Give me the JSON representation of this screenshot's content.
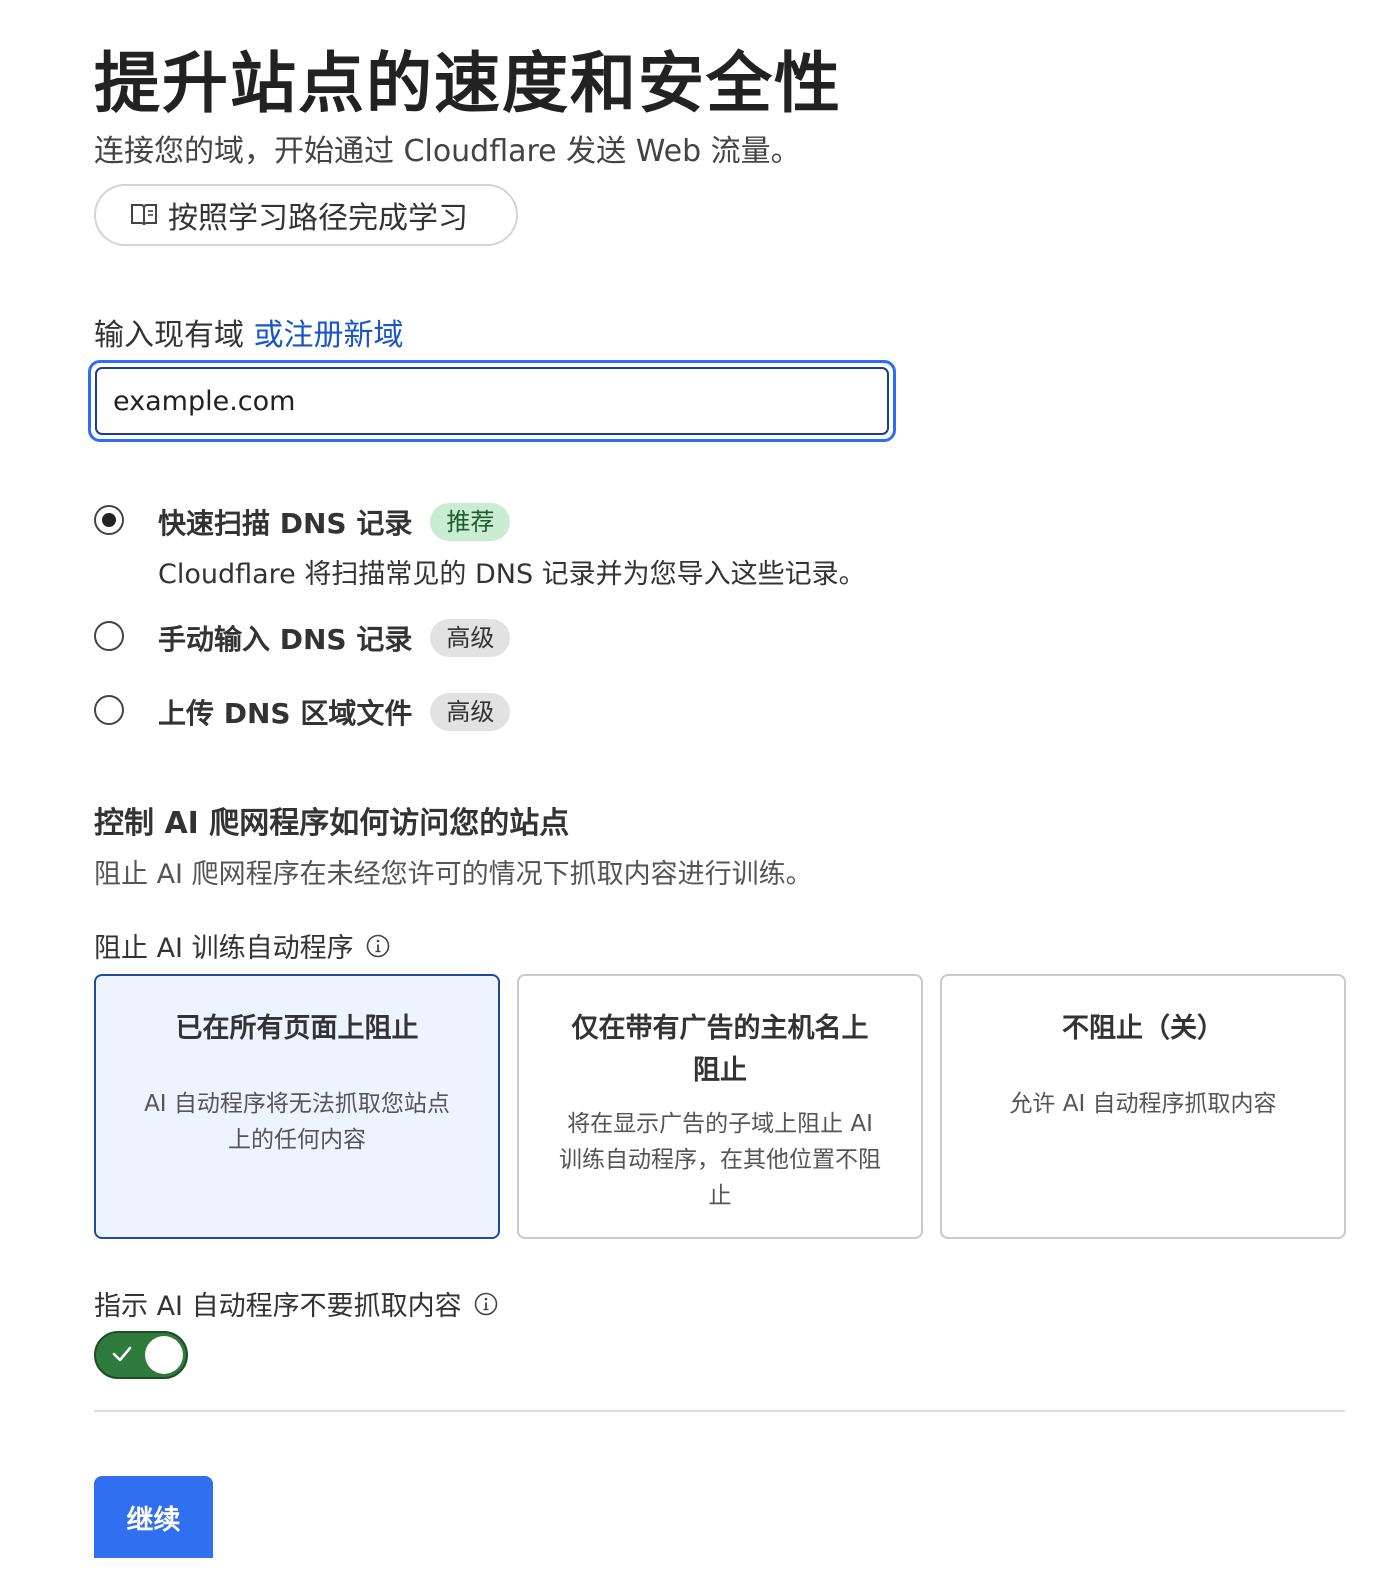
{
  "header": {
    "title": "提升站点的速度和安全性",
    "subtitle": "连接您的域，开始通过 Cloudflare 发送 Web 流量。",
    "learn_button": "按照学习路径完成学习"
  },
  "domain": {
    "label": "输入现有域",
    "register_link": "或注册新域",
    "input_value": "example.com"
  },
  "dns_options": [
    {
      "title": "快速扫描 DNS 记录",
      "badge": "推荐",
      "description": "Cloudflare 将扫描常见的 DNS 记录并为您导入这些记录。",
      "checked": true
    },
    {
      "title": "手动输入 DNS 记录",
      "badge": "高级",
      "checked": false
    },
    {
      "title": "上传 DNS 区域文件",
      "badge": "高级",
      "checked": false
    }
  ],
  "ai_section": {
    "heading": "控制 AI 爬网程序如何访问您的站点",
    "description": "阻止 AI 爬网程序在未经您许可的情况下抓取内容进行训练。",
    "block_label": "阻止 AI 训练自动程序",
    "cards": [
      {
        "title": "已在所有页面上阻止",
        "description": "AI 自动程序将无法抓取您站点上的任何内容",
        "selected": true
      },
      {
        "title": "仅在带有广告的主机名上阻止",
        "description": "将在显示广告的子域上阻止 AI 训练自动程序，在其他位置不阻止",
        "selected": false
      },
      {
        "title": "不阻止（关）",
        "description": "允许 AI 自动程序抓取内容",
        "selected": false
      }
    ],
    "instruct_label": "指示 AI 自动程序不要抓取内容",
    "instruct_enabled": true
  },
  "footer": {
    "continue_button": "继续"
  },
  "colors": {
    "accent": "#2f6ff0",
    "link": "#1a56c8",
    "toggle_on": "#2f7a3d",
    "selected_card_bg": "#eef4ff",
    "badge_green": "#c9ecd2",
    "badge_gray": "#e2e2e2"
  }
}
